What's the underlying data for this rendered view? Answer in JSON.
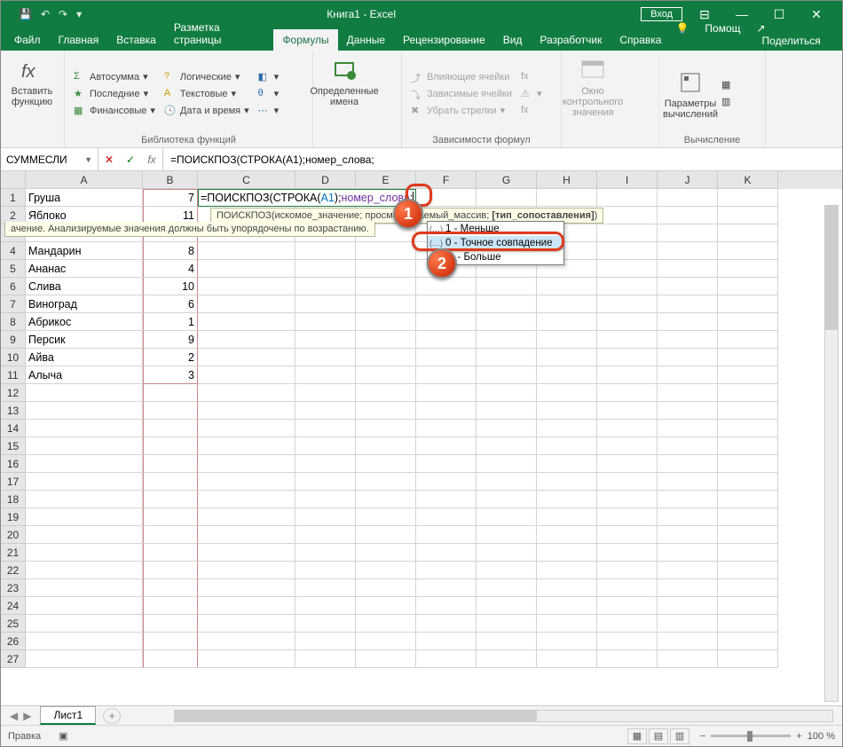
{
  "title": "Книга1  -  Excel",
  "loginLabel": "Вход",
  "qat": {
    "save": "💾",
    "undo": "↶",
    "redo": "↷",
    "more": "▾"
  },
  "tabs": [
    "Файл",
    "Главная",
    "Вставка",
    "Разметка страницы",
    "Формулы",
    "Данные",
    "Рецензирование",
    "Вид",
    "Разработчик",
    "Справка"
  ],
  "activeTab": "Формулы",
  "help": "Помощ",
  "share": "Поделиться",
  "ribbon": {
    "group1": {
      "insertFunction": "Вставить функцию",
      "autosum": "Автосумма",
      "recent": "Последние",
      "financial": "Финансовые",
      "logical": "Логические",
      "text": "Текстовые",
      "datetime": "Дата и время",
      "label": "Библиотека функций"
    },
    "group2": {
      "definedNames": "Определенные имена"
    },
    "group3": {
      "tracePrec": "Влияющие ячейки",
      "traceDep": "Зависимые ячейки",
      "removeArrows": "Убрать стрелки",
      "label": "Зависимости формул"
    },
    "group4": {
      "watch": "Окно контрольного значения"
    },
    "group5": {
      "calcOptions": "Параметры вычислений",
      "label": "Вычисление"
    }
  },
  "nameBox": "СУММЕСЛИ",
  "formulaBarText": "=ПОИСКПОЗ(СТРОКА(A1);номер_слова;",
  "editCell": {
    "p1": "=ПОИСКПОЗ(СТРОКА(",
    "ref": "A1",
    "p2": ");",
    "name": "номер_слова",
    "p3": ";"
  },
  "tooltip": {
    "text1": "ПОИСКПОЗ(",
    "arg1": "искомое_значение",
    "sep1": "; ",
    "arg2": "просматриваемый_массив",
    "sep2": "; ",
    "arg3": "[тип_сопоставления]",
    "text2": ")",
    "extra": "ачение. Анализируемые значения должны быть упорядочены по возрастанию."
  },
  "autocomplete": {
    "opt1": "1 - Меньше",
    "opt2": "0 - Точное совпадение",
    "opt3": "-1 - Больше"
  },
  "columns": [
    "A",
    "B",
    "C",
    "D",
    "E",
    "F",
    "G",
    "H",
    "I",
    "J",
    "K"
  ],
  "data": {
    "a": [
      "Груша",
      "Яблоко",
      "",
      "Мандарин",
      "Ананас",
      "Слива",
      "Виноград",
      "Абрикос",
      "Персик",
      "Айва",
      "Алыча"
    ],
    "b": [
      "7",
      "11",
      "",
      "8",
      "4",
      "10",
      "6",
      "1",
      "9",
      "2",
      "3"
    ]
  },
  "rowCount": 27,
  "sheetTab": "Лист1",
  "status": "Правка",
  "zoom": "100 %",
  "callouts": {
    "one": "1",
    "two": "2"
  }
}
